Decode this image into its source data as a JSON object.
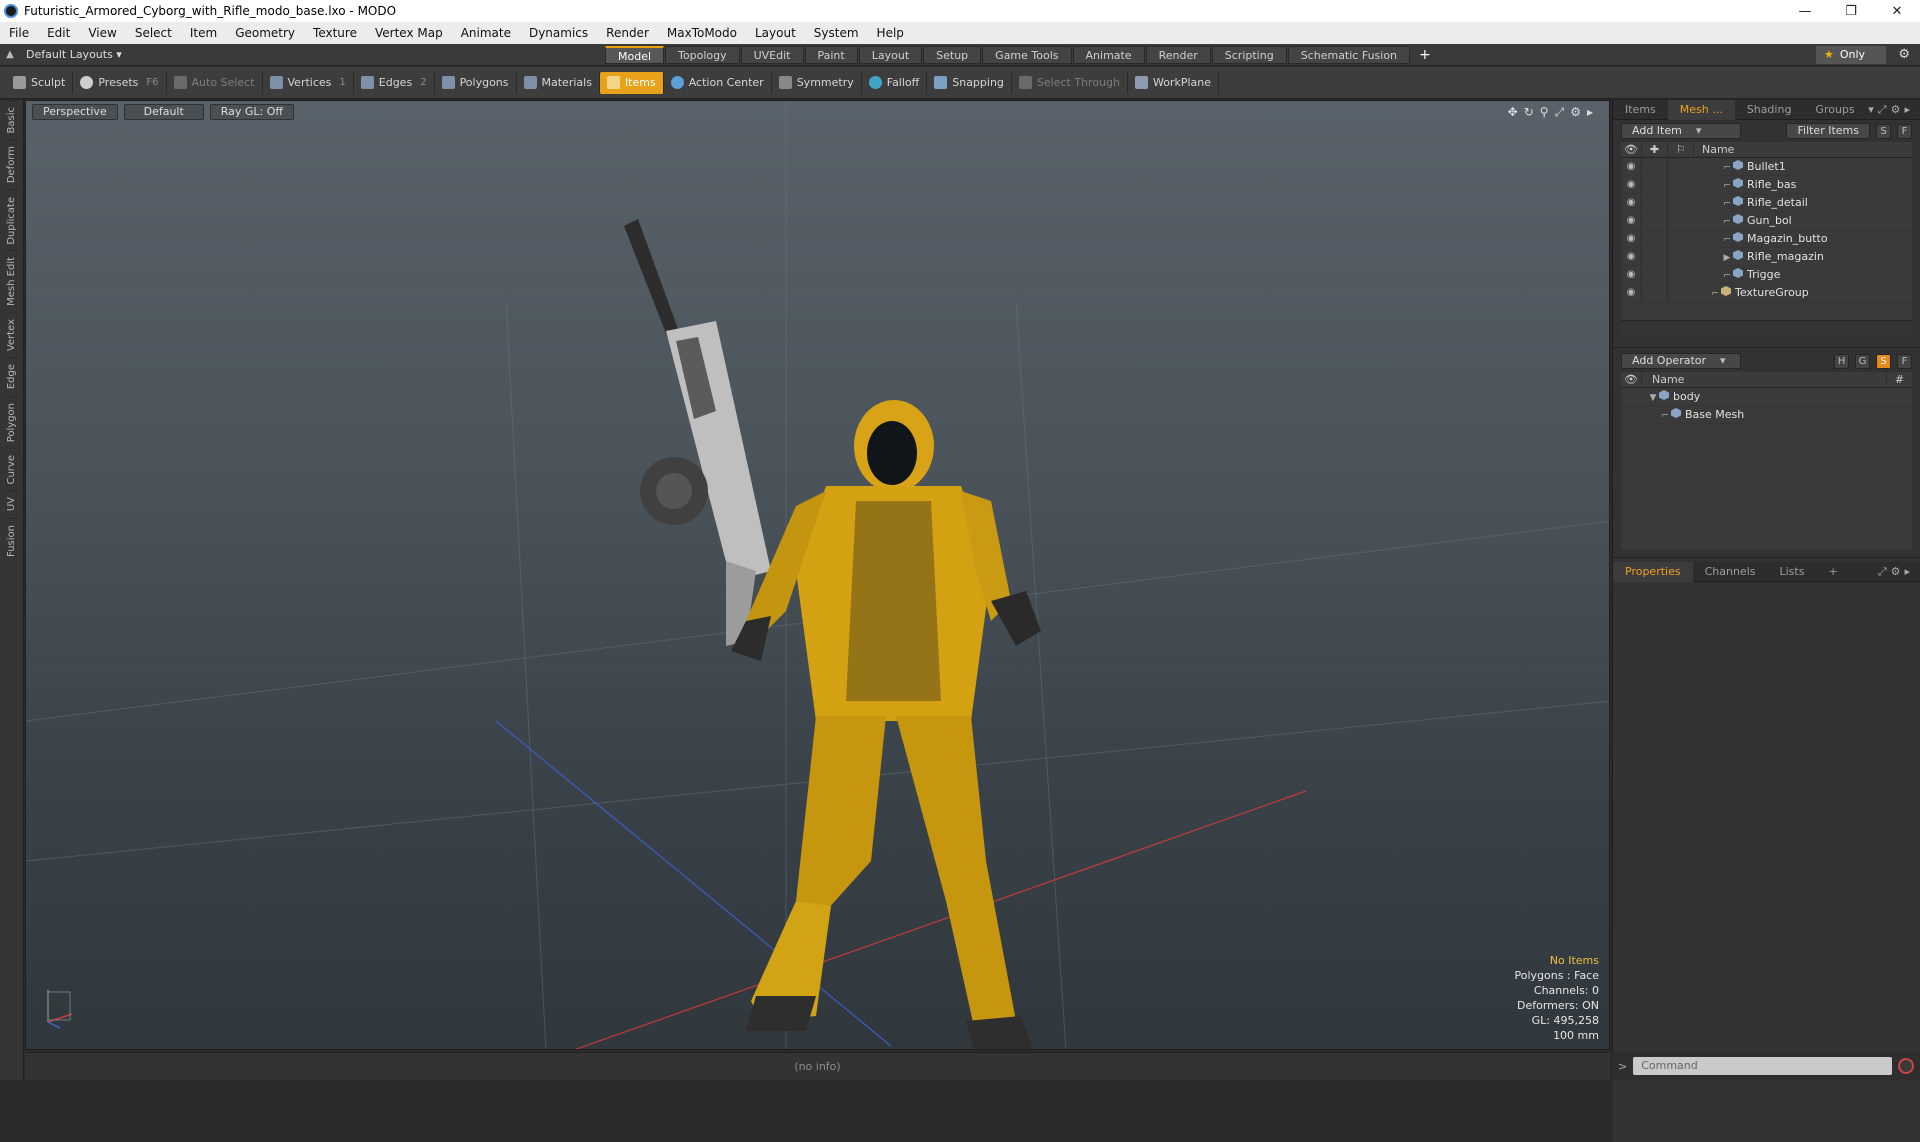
{
  "window": {
    "title": "Futuristic_Armored_Cyborg_with_Rifle_modo_base.lxo - MODO",
    "min": "—",
    "restore": "❐",
    "close": "✕"
  },
  "menu": [
    "File",
    "Edit",
    "View",
    "Select",
    "Item",
    "Geometry",
    "Texture",
    "Vertex Map",
    "Animate",
    "Dynamics",
    "Render",
    "MaxToModo",
    "Layout",
    "System",
    "Help"
  ],
  "layoutbar": {
    "layout_select": "Default Layouts ▾",
    "tabs": [
      "Model",
      "Topology",
      "UVEdit",
      "Paint",
      "Layout",
      "Setup",
      "Game Tools",
      "Animate",
      "Render",
      "Scripting",
      "Schematic Fusion"
    ],
    "active_tab": "Model",
    "add": "+",
    "only": "Only"
  },
  "toolbar": {
    "sculpt": "Sculpt",
    "presets": "Presets",
    "presets_key": "F6",
    "auto_select": "Auto Select",
    "vertices": "Vertices",
    "vertices_key": "1",
    "edges": "Edges",
    "edges_key": "2",
    "polygons": "Polygons",
    "materials": "Materials",
    "items": "Items",
    "action_center": "Action Center",
    "symmetry": "Symmetry",
    "falloff": "Falloff",
    "snapping": "Snapping",
    "select_through": "Select Through",
    "workplane": "WorkPlane"
  },
  "left_tabs": [
    "Basic",
    "Deform",
    "Duplicate",
    "Mesh Edit",
    "Vertex",
    "Edge",
    "Polygon",
    "Curve",
    "UV",
    "Fusion"
  ],
  "viewport": {
    "view_mode": "Perspective",
    "shading": "Default",
    "raygl": "Ray GL: Off",
    "info": {
      "items": "No Items",
      "polygons": "Polygons : Face",
      "channels": "Channels: 0",
      "deformers": "Deformers: ON",
      "gl": "GL: 495,258",
      "scale": "100 mm"
    }
  },
  "status": "(no info)",
  "items_panel": {
    "tabs": [
      "Items",
      "Mesh ...",
      "Shading",
      "Groups"
    ],
    "active_tab": "Mesh ...",
    "add_item": "Add Item",
    "filter": "Filter Items",
    "s": "S",
    "f": "F",
    "header_name": "Name",
    "rows": [
      {
        "name": "Bullet1",
        "indent": 1,
        "expand": false
      },
      {
        "name": "Rifle_bas",
        "indent": 1,
        "expand": false
      },
      {
        "name": "Rifle_detail",
        "indent": 1,
        "expand": false
      },
      {
        "name": "Gun_bol",
        "indent": 1,
        "expand": false
      },
      {
        "name": "Magazin_butto",
        "indent": 1,
        "expand": false
      },
      {
        "name": "Rifle_magazin",
        "indent": 1,
        "expand": true
      },
      {
        "name": "Trigge",
        "indent": 1,
        "expand": false
      },
      {
        "name": "TextureGroup",
        "indent": 0,
        "expand": false
      }
    ]
  },
  "operator_panel": {
    "add_operator": "Add Operator",
    "h": "H",
    "g": "G",
    "s": "S",
    "f": "F",
    "header_name": "Name",
    "header_hash": "#",
    "rows": [
      {
        "name": "body",
        "indent": 0
      },
      {
        "name": "Base Mesh",
        "indent": 1
      }
    ]
  },
  "props_panel": {
    "tabs": [
      "Properties",
      "Channels",
      "Lists"
    ],
    "active_tab": "Properties",
    "add": "+"
  },
  "command": {
    "placeholder": "Command",
    "prompt": ">"
  }
}
